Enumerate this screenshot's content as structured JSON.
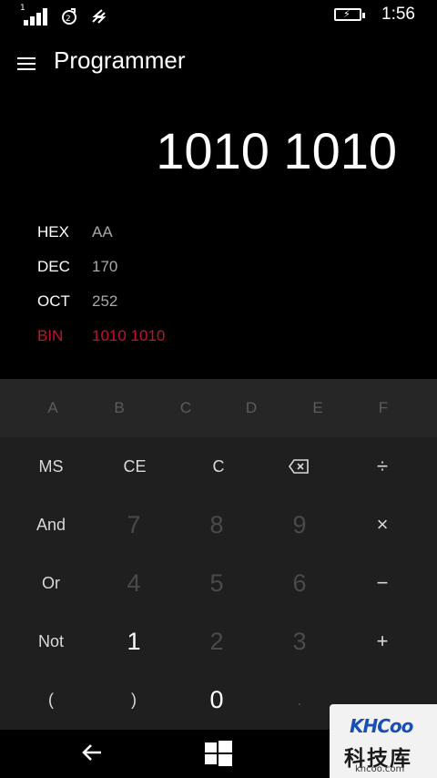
{
  "status_bar": {
    "sim_number": "1",
    "time": "1:56"
  },
  "header": {
    "title": "Programmer"
  },
  "display": {
    "value": "1010 1010"
  },
  "radix": [
    {
      "label": "HEX",
      "value": "AA",
      "active": false
    },
    {
      "label": "DEC",
      "value": "170",
      "active": false
    },
    {
      "label": "OCT",
      "value": "252",
      "active": false
    },
    {
      "label": "BIN",
      "value": "1010 1010",
      "active": true
    }
  ],
  "keypad": {
    "hex_keys": [
      "A",
      "B",
      "C",
      "D",
      "E",
      "F"
    ],
    "ms": "MS",
    "ce": "CE",
    "c": "C",
    "divide": "÷",
    "and": "And",
    "or": "Or",
    "not": "Not",
    "multiply": "×",
    "minus": "−",
    "plus": "+",
    "open_paren": "(",
    "close_paren": ")",
    "decimal": ".",
    "digits": {
      "d0": "0",
      "d1": "1",
      "d2": "2",
      "d3": "3",
      "d4": "4",
      "d5": "5",
      "d6": "6",
      "d7": "7",
      "d8": "8",
      "d9": "9"
    }
  },
  "watermark": {
    "logo": "KHCoo",
    "chinese": "科技库",
    "url": "khcoo.com"
  },
  "colors": {
    "accent": "#c8102e",
    "keypad_bg": "#1f1f1f",
    "hex_row_bg": "#262626"
  }
}
